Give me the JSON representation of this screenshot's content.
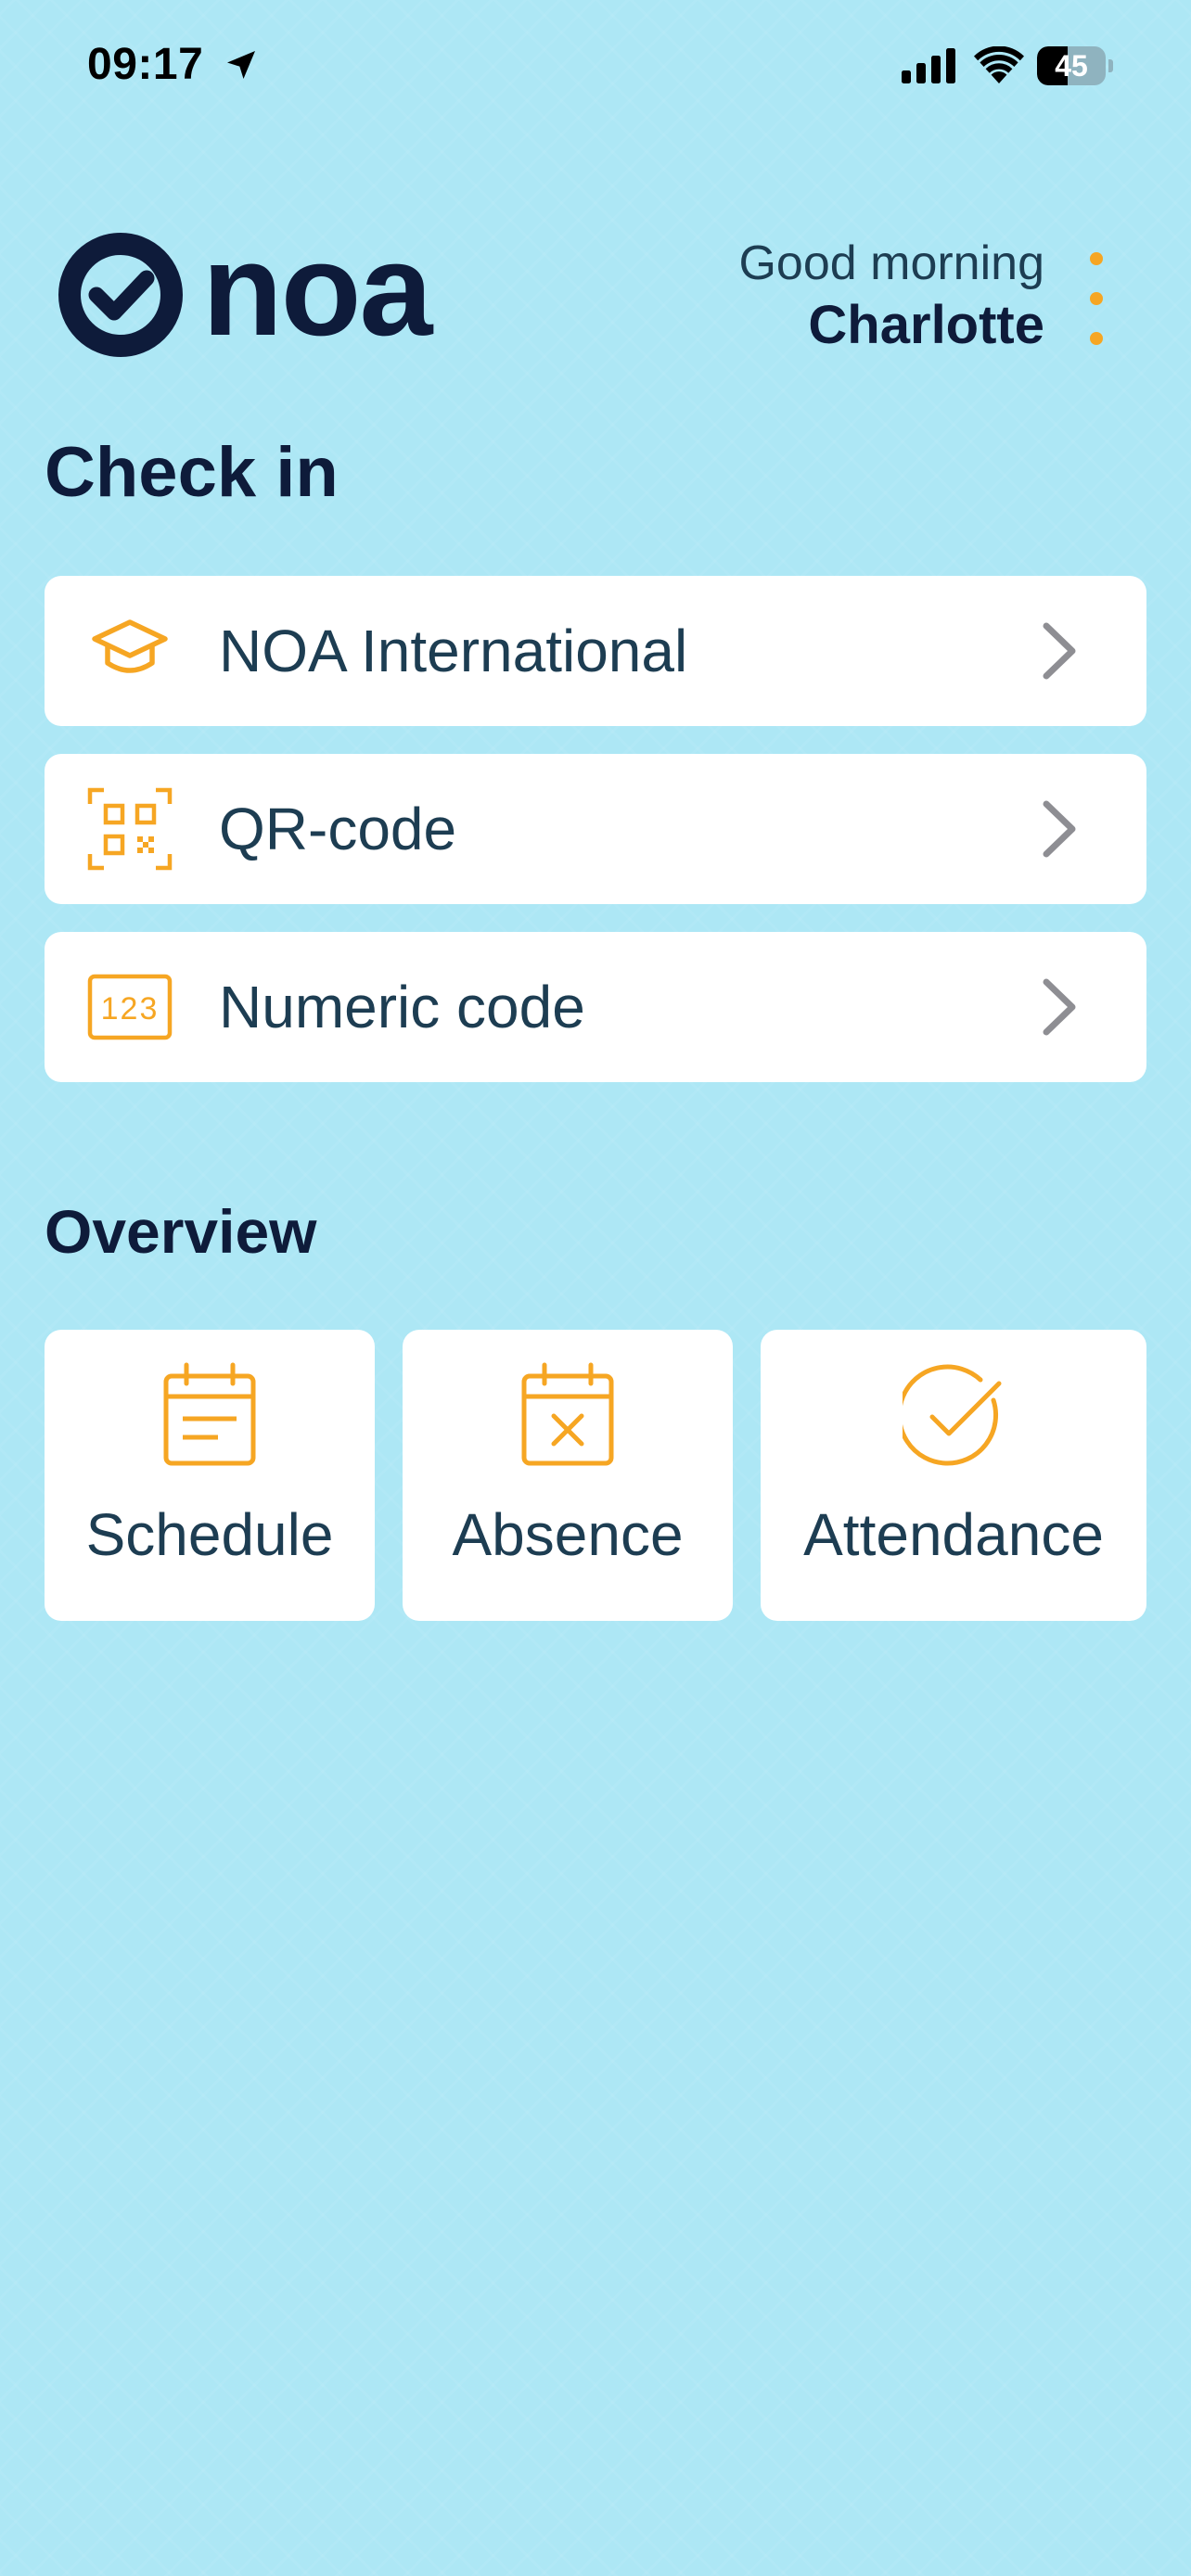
{
  "status_bar": {
    "time": "09:17",
    "battery_percent": "45",
    "battery_level": 0.45,
    "icons": [
      "location-arrow-icon",
      "cellular-signal-icon",
      "wifi-icon",
      "battery-icon"
    ]
  },
  "header": {
    "logo_text": "noa",
    "greeting": "Good morning",
    "user_name": "Charlotte",
    "menu_icon": "more-vertical-icon"
  },
  "checkin": {
    "title": "Check in",
    "items": [
      {
        "label": "NOA International",
        "icon": "graduation-cap-icon"
      },
      {
        "label": "QR-code",
        "icon": "qr-code-icon"
      },
      {
        "label": "Numeric code",
        "icon": "numeric-code-icon",
        "icon_text": "123"
      }
    ]
  },
  "overview": {
    "title": "Overview",
    "items": [
      {
        "label": "Schedule",
        "icon": "calendar-schedule-icon"
      },
      {
        "label": "Absence",
        "icon": "calendar-absence-icon"
      },
      {
        "label": "Attendance",
        "icon": "check-circle-icon"
      }
    ]
  },
  "colors": {
    "background": "#ade7f5",
    "accent": "#f6a623",
    "text_dark": "#0e1b3a",
    "text_body": "#1d3d52",
    "chevron": "#8e8e93"
  }
}
